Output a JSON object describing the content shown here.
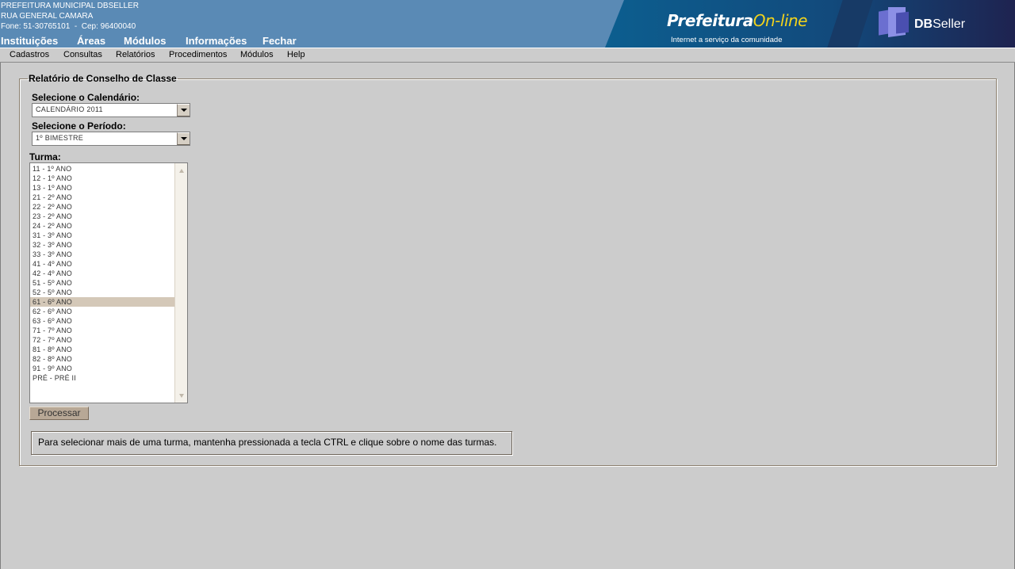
{
  "header": {
    "org_name": "PREFEITURA MUNICIPAL DBSELLER",
    "address": "RUA GENERAL CAMARA",
    "contact": "Fone: 51-30765101  -  Cep: 96400040",
    "nav": [
      "Instituições",
      "Áreas",
      "Módulos",
      "Informações",
      "Fechar"
    ]
  },
  "banner": {
    "brand_main": "Prefeitura",
    "brand_accent": "On-line",
    "tagline": "Internet a serviço da comunidade",
    "logo_bold": "DB",
    "logo_rest": "Seller",
    "accent_color": "#f2d31b"
  },
  "menubar": [
    "Cadastros",
    "Consultas",
    "Relatórios",
    "Procedimentos",
    "Módulos",
    "Help"
  ],
  "form": {
    "legend": "Relatório de Conselho de Classe",
    "calendar_label": "Selecione o Calendário:",
    "calendar_value": "CALENDÁRIO 2011",
    "period_label": "Selecione o Período:",
    "period_value": "1º BIMESTRE",
    "turma_label": "Turma:",
    "turmas": [
      "11 - 1º ANO",
      "12 - 1º ANO",
      "13 - 1º ANO",
      "21 - 2º ANO",
      "22 - 2º ANO",
      "23 - 2º ANO",
      "24 - 2º ANO",
      "31 - 3º ANO",
      "32 - 3º ANO",
      "33 - 3º ANO",
      "41 - 4º ANO",
      "42 - 4º ANO",
      "51 - 5º ANO",
      "52 - 5º ANO",
      "61 - 6º ANO",
      "62 - 6º ANO",
      "63 - 6º ANO",
      "71 - 7º ANO",
      "72 - 7º ANO",
      "81 - 8º ANO",
      "82 - 8º ANO",
      "91 - 9º ANO",
      "PRÉ - PRÉ II"
    ],
    "selected_turma": "61 - 6º ANO",
    "process_button": "Processar",
    "hint": "Para selecionar mais de uma turma, mantenha pressionada a tecla CTRL e clique sobre o nome das turmas."
  }
}
